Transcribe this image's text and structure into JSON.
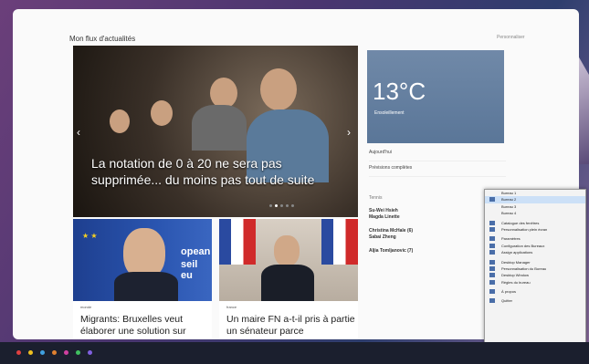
{
  "header": {
    "title": "Mon flux d'actualités",
    "subtitle": "",
    "personalize": "Personnaliser"
  },
  "hero": {
    "caption": "La notation de 0 à 20 ne sera pas supprimée... du moins pas tout de suite",
    "source": "",
    "prev_icon": "chevron-left-icon",
    "next_icon": "chevron-right-icon",
    "slide_count": 5,
    "active_slide": 1
  },
  "cards": [
    {
      "category": "monde",
      "title": "Migrants: Bruxelles veut élaborer une solution sur",
      "image_text_1": "opean",
      "image_text_2": "seil eu"
    },
    {
      "category": "france",
      "title": "Un maire FN a-t-il pris à partie un sénateur parce",
      "image_text_1": "",
      "image_text_2": ""
    }
  ],
  "weather": {
    "location": "",
    "temperature": "13°C",
    "description": "Ensoleillement",
    "meta_1": "",
    "meta_2": "",
    "date": ""
  },
  "side_rows": [
    {
      "left": "Aujourd'hui",
      "right": ""
    },
    {
      "left": "Prévisions complètes",
      "right": ""
    }
  ],
  "side_news": {
    "label": "Tennis",
    "items": [
      {
        "line1": "Su-Wei Hsieh",
        "line2": "Magda Linette"
      },
      {
        "line1": "Christina McHale (6)",
        "line2": "Sabai Zheng"
      },
      {
        "line1": "Aljia Tomljanovic (7)",
        "line2": ""
      }
    ]
  },
  "context_menu": {
    "items": [
      {
        "label": "Bureau 1",
        "selected": false,
        "icon": false
      },
      {
        "label": "Bureau 2",
        "selected": true,
        "icon": true
      },
      {
        "label": "Bureau 3",
        "selected": false,
        "icon": false
      },
      {
        "label": "Bureau 4",
        "selected": false,
        "icon": false
      },
      {
        "label": "",
        "selected": false,
        "icon": false,
        "separator": true
      },
      {
        "label": "Catalogue des fenêtres",
        "selected": false,
        "icon": true
      },
      {
        "label": "Personnalisation plein écran",
        "selected": false,
        "icon": true
      },
      {
        "label": "",
        "selected": false,
        "icon": false,
        "separator": true
      },
      {
        "label": "Paramètres",
        "selected": false,
        "icon": true
      },
      {
        "label": "Configuration des Bureaux",
        "selected": false,
        "icon": true
      },
      {
        "label": "Assign applications",
        "selected": false,
        "icon": true
      },
      {
        "label": "",
        "selected": false,
        "icon": false,
        "separator": true
      },
      {
        "label": "Desktop Manager",
        "selected": false,
        "icon": true
      },
      {
        "label": "Personnalisation du Bureau",
        "selected": false,
        "icon": true
      },
      {
        "label": "Desktop Window",
        "selected": false,
        "icon": true
      },
      {
        "label": "Règles du bureau",
        "selected": false,
        "icon": true
      },
      {
        "label": "",
        "selected": false,
        "icon": false,
        "separator": true
      },
      {
        "label": "À propos",
        "selected": false,
        "icon": true
      },
      {
        "label": "",
        "selected": false,
        "icon": false,
        "separator": true
      },
      {
        "label": "Quitter",
        "selected": false,
        "icon": true
      }
    ]
  },
  "taskbar": {
    "icons": [
      "#e04040",
      "#f0c020",
      "#40a0e0",
      "#e08030",
      "#d040a0",
      "#40c060",
      "#8060e0"
    ]
  }
}
